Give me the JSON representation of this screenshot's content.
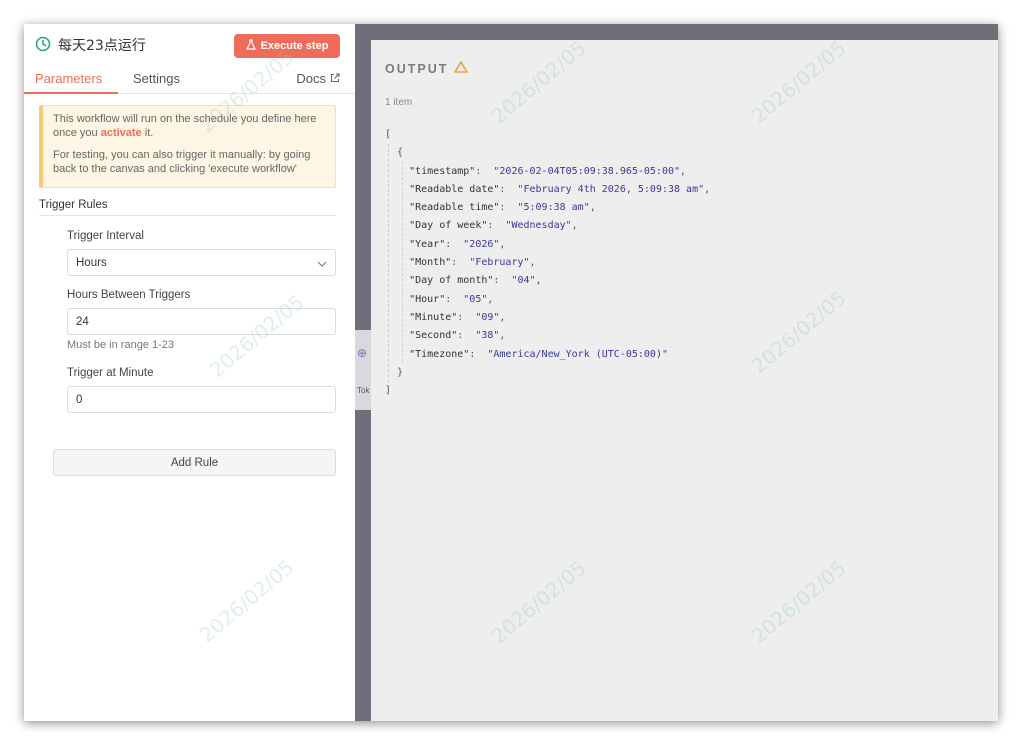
{
  "node": {
    "title": "每天23点运行",
    "execute_label": "Execute step"
  },
  "tabs": [
    {
      "label": "Parameters",
      "active": true
    },
    {
      "label": "Settings",
      "active": false
    }
  ],
  "docs_label": "Docs",
  "notice": {
    "line1_prefix": "This workflow will run on the schedule you define here once you ",
    "line1_link": "activate",
    "line1_suffix": " it.",
    "line2": "For testing, you can also trigger it manually: by going back to the canvas and clicking 'execute workflow'"
  },
  "trigger_rules": {
    "title": "Trigger Rules",
    "interval_label": "Trigger Interval",
    "interval_value": "Hours",
    "hours_label": "Hours Between Triggers",
    "hours_value": "24",
    "hours_hint": "Must be in range 1-23",
    "minute_label": "Trigger at Minute",
    "minute_value": "0",
    "add_rule_label": "Add Rule"
  },
  "output": {
    "title": "OUTPUT",
    "items_count": "1 item",
    "json_open": "[",
    "object_open": "{",
    "object_close": "}",
    "json_close": "]",
    "fields": [
      {
        "key": "\"timestamp\"",
        "value": "\"2026-02-04T05:09:38.965-05:00\""
      },
      {
        "key": "\"Readable date\"",
        "value": "\"February 4th 2026, 5:09:38 am\""
      },
      {
        "key": "\"Readable time\"",
        "value": "\"5:09:38 am\""
      },
      {
        "key": "\"Day of week\"",
        "value": "\"Wednesday\""
      },
      {
        "key": "\"Year\"",
        "value": "\"2026\""
      },
      {
        "key": "\"Month\"",
        "value": "\"February\""
      },
      {
        "key": "\"Day of month\"",
        "value": "\"04\""
      },
      {
        "key": "\"Hour\"",
        "value": "\"05\""
      },
      {
        "key": "\"Minute\"",
        "value": "\"09\""
      },
      {
        "key": "\"Second\"",
        "value": "\"38\""
      },
      {
        "key": "\"Timezone\"",
        "value": "\"America/New_York (UTC-05:00)\""
      }
    ]
  },
  "canvas_peek_text": "Tok",
  "watermark_text": "2026/02/05",
  "colors": {
    "accent": "#f06c5a",
    "notice_bg": "#fef5e4",
    "json_value": "#3a3a99",
    "warning": "#e8a33d",
    "clock": "#2aa876"
  }
}
